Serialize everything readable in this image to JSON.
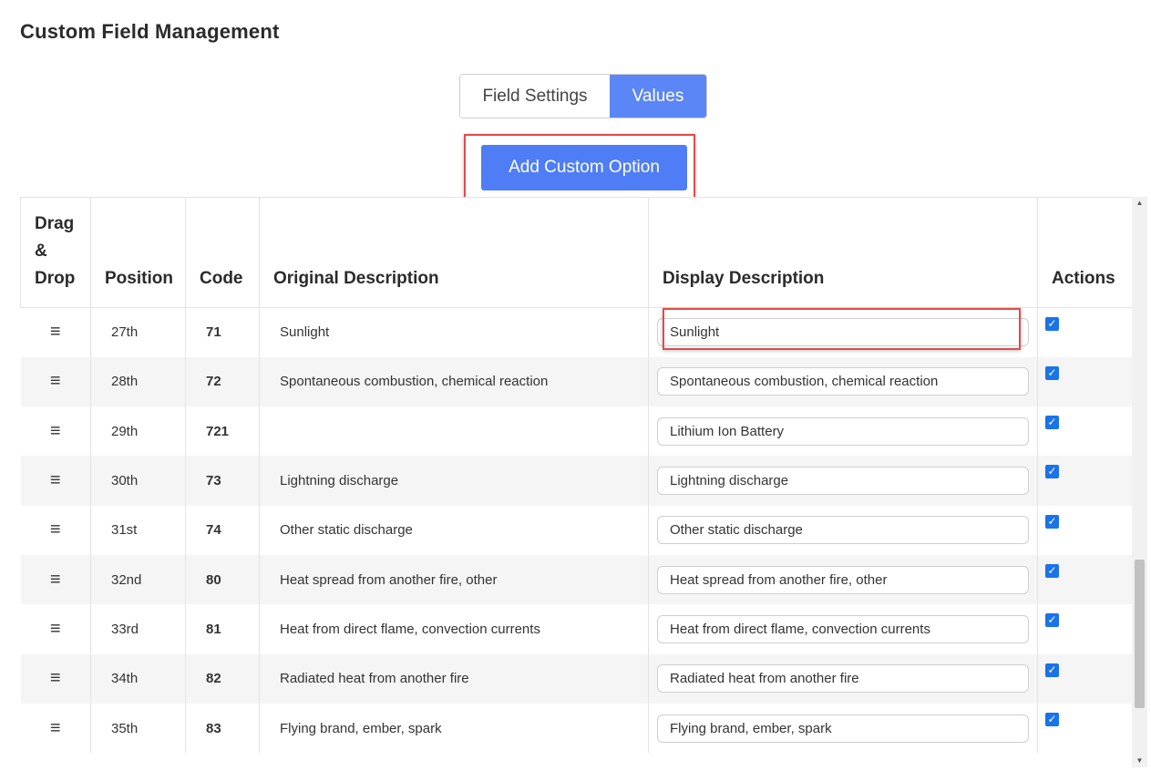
{
  "page": {
    "title": "Custom Field Management"
  },
  "tabs": [
    {
      "label": "Field Settings",
      "active": false
    },
    {
      "label": "Values",
      "active": true
    }
  ],
  "add_button": {
    "label": "Add Custom Option"
  },
  "table": {
    "headers": {
      "drag": "Drag & Drop",
      "position": "Position",
      "code": "Code",
      "original": "Original Description",
      "display": "Display Description",
      "actions": "Actions"
    },
    "rows": [
      {
        "position": "27th",
        "code": "71",
        "original": "Sunlight",
        "display": "Sunlight",
        "checked": true
      },
      {
        "position": "28th",
        "code": "72",
        "original": "Spontaneous combustion, chemical reaction",
        "display": "Spontaneous combustion, chemical reaction",
        "checked": true
      },
      {
        "position": "29th",
        "code": "721",
        "original": "",
        "display": "Lithium Ion Battery",
        "checked": true
      },
      {
        "position": "30th",
        "code": "73",
        "original": "Lightning discharge",
        "display": "Lightning discharge",
        "checked": true
      },
      {
        "position": "31st",
        "code": "74",
        "original": "Other static discharge",
        "display": "Other static discharge",
        "checked": true
      },
      {
        "position": "32nd",
        "code": "80",
        "original": "Heat spread from another fire, other",
        "display": "Heat spread from another fire, other",
        "checked": true
      },
      {
        "position": "33rd",
        "code": "81",
        "original": "Heat from direct flame, convection currents",
        "display": "Heat from direct flame, convection currents",
        "checked": true
      },
      {
        "position": "34th",
        "code": "82",
        "original": "Radiated heat from another fire",
        "display": "Radiated heat from another fire",
        "checked": true
      },
      {
        "position": "35th",
        "code": "83",
        "original": "Flying brand, ember, spark",
        "display": "Flying brand, ember, spark",
        "checked": true
      }
    ]
  },
  "icons": {
    "drag_handle": "hamburger-icon",
    "checkbox": "checkmark-icon",
    "scroll_up": "arrow-up-icon",
    "scroll_down": "arrow-down-icon"
  },
  "colors": {
    "accent": "#4f7df5",
    "active_tab": "#5b86f5",
    "highlight": "#e04b4b",
    "checkbox": "#1a73e8"
  }
}
